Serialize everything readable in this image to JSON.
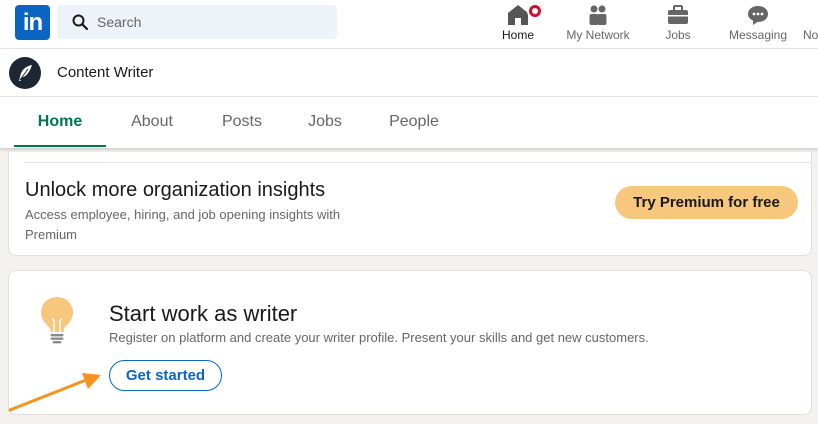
{
  "global_nav": {
    "logo_text": "in",
    "search_placeholder": "Search",
    "items": [
      {
        "label": "Home",
        "icon": "home-icon"
      },
      {
        "label": "My Network",
        "icon": "people-icon"
      },
      {
        "label": "Jobs",
        "icon": "briefcase-icon"
      },
      {
        "label": "Messaging",
        "icon": "chat-icon"
      },
      {
        "label": "No",
        "icon": "bell-icon"
      }
    ]
  },
  "org": {
    "name": "Content Writer",
    "avatar_icon": "feather-icon"
  },
  "tabs": [
    {
      "label": "Home",
      "active": true
    },
    {
      "label": "About"
    },
    {
      "label": "Posts"
    },
    {
      "label": "Jobs"
    },
    {
      "label": "People"
    }
  ],
  "premium_card": {
    "title": "Unlock more organization insights",
    "description": "Access employee, hiring, and job opening insights with Premium",
    "button": "Try Premium for free"
  },
  "writer_card": {
    "icon": "lightbulb-icon",
    "title": "Start work as writer",
    "description": "Register on platform and create your writer profile. Present your skills and get new customers.",
    "button": "Get started"
  },
  "colors": {
    "brand": "#0a66c2",
    "active_tab": "#01754f",
    "premium_button": "#f8c77e",
    "annotation_arrow": "#f7931e"
  }
}
